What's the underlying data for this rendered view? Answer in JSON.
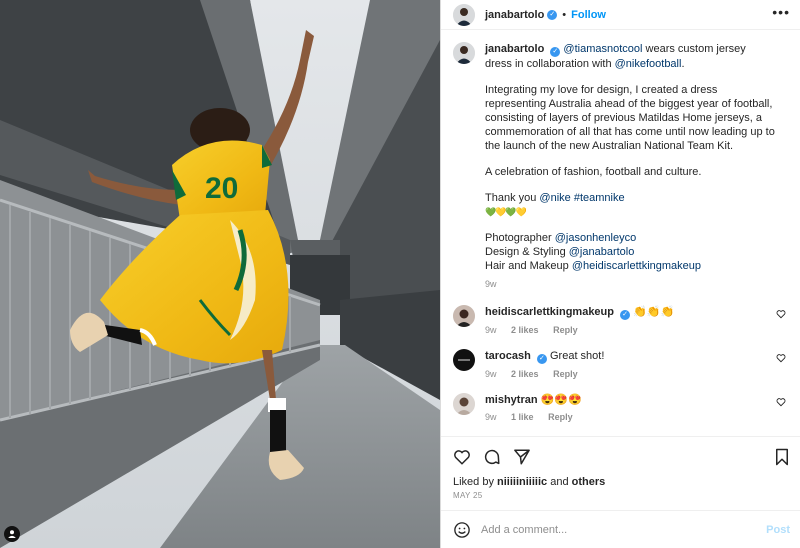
{
  "post": {
    "author": "janabartolo",
    "follow_label": "Follow",
    "separator": "•",
    "more_label": "•••",
    "verified_mark": "✓"
  },
  "caption": {
    "username": "janabartolo",
    "mention_1": "@tiamasnotcool",
    "text_1": " wears custom jersey dress in collaboration with ",
    "mention_2": "@nikefootball",
    "text_1_end": ".",
    "paragraph_2": "Integrating my love for design, I created a dress representing Australia ahead of the biggest year of football, consisting of layers of previous Matildas Home jerseys, a commemoration of all that has come until now leading up to the launch of the new Australian National Team Kit.",
    "paragraph_3": "A celebration of fashion, football and culture.",
    "thanks_text": "Thank you ",
    "thanks_mention": "@nike",
    "thanks_tag": "#teamnike",
    "emojis": "💚💛💚💛",
    "photographer_label": "Photographer ",
    "photographer": "@jasonhenleyco",
    "design_label": "Design & Styling ",
    "designer": "@janabartolo",
    "hair_label": "Hair and Makeup ",
    "hair": "@heidiscarlettkingmakeup",
    "time": "9w"
  },
  "comments": [
    {
      "username": "heidiscarlettkingmakeup",
      "verified": true,
      "text": "👏👏👏",
      "time": "9w",
      "likes": "2 likes",
      "reply": "Reply"
    },
    {
      "username": "tarocash",
      "verified": true,
      "text": "Great shot!",
      "time": "9w",
      "likes": "2 likes",
      "reply": "Reply"
    },
    {
      "username": "mishytran",
      "verified": false,
      "text": "😍😍😍",
      "time": "9w",
      "likes": "1 like",
      "reply": "Reply"
    }
  ],
  "likes": {
    "prefix": "Liked by ",
    "user": "niiiiiniiiiic",
    "middle": " and ",
    "others": "others"
  },
  "date": "MAY 25",
  "add_comment": {
    "placeholder": "Add a comment...",
    "post_label": "Post"
  },
  "colors": {
    "accent": "#0095f6",
    "verified": "#3897f0",
    "mention": "#00376b",
    "muted": "#8e8e8e",
    "jersey": "#f2c21a",
    "jersey_green": "#0f6b3a"
  },
  "icons": [
    "heart-icon",
    "comment-icon",
    "share-icon",
    "bookmark-icon",
    "emoji-icon",
    "user-tag-icon",
    "more-icon",
    "verified-icon"
  ]
}
